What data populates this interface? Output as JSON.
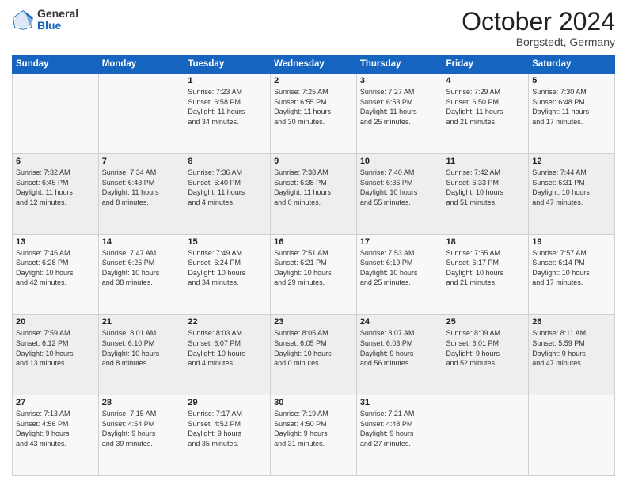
{
  "logo": {
    "general": "General",
    "blue": "Blue"
  },
  "header": {
    "month": "October 2024",
    "location": "Borgstedt, Germany"
  },
  "weekdays": [
    "Sunday",
    "Monday",
    "Tuesday",
    "Wednesday",
    "Thursday",
    "Friday",
    "Saturday"
  ],
  "weeks": [
    [
      {
        "day": "",
        "info": ""
      },
      {
        "day": "",
        "info": ""
      },
      {
        "day": "1",
        "info": "Sunrise: 7:23 AM\nSunset: 6:58 PM\nDaylight: 11 hours\nand 34 minutes."
      },
      {
        "day": "2",
        "info": "Sunrise: 7:25 AM\nSunset: 6:55 PM\nDaylight: 11 hours\nand 30 minutes."
      },
      {
        "day": "3",
        "info": "Sunrise: 7:27 AM\nSunset: 6:53 PM\nDaylight: 11 hours\nand 25 minutes."
      },
      {
        "day": "4",
        "info": "Sunrise: 7:29 AM\nSunset: 6:50 PM\nDaylight: 11 hours\nand 21 minutes."
      },
      {
        "day": "5",
        "info": "Sunrise: 7:30 AM\nSunset: 6:48 PM\nDaylight: 11 hours\nand 17 minutes."
      }
    ],
    [
      {
        "day": "6",
        "info": "Sunrise: 7:32 AM\nSunset: 6:45 PM\nDaylight: 11 hours\nand 12 minutes."
      },
      {
        "day": "7",
        "info": "Sunrise: 7:34 AM\nSunset: 6:43 PM\nDaylight: 11 hours\nand 8 minutes."
      },
      {
        "day": "8",
        "info": "Sunrise: 7:36 AM\nSunset: 6:40 PM\nDaylight: 11 hours\nand 4 minutes."
      },
      {
        "day": "9",
        "info": "Sunrise: 7:38 AM\nSunset: 6:38 PM\nDaylight: 11 hours\nand 0 minutes."
      },
      {
        "day": "10",
        "info": "Sunrise: 7:40 AM\nSunset: 6:36 PM\nDaylight: 10 hours\nand 55 minutes."
      },
      {
        "day": "11",
        "info": "Sunrise: 7:42 AM\nSunset: 6:33 PM\nDaylight: 10 hours\nand 51 minutes."
      },
      {
        "day": "12",
        "info": "Sunrise: 7:44 AM\nSunset: 6:31 PM\nDaylight: 10 hours\nand 47 minutes."
      }
    ],
    [
      {
        "day": "13",
        "info": "Sunrise: 7:45 AM\nSunset: 6:28 PM\nDaylight: 10 hours\nand 42 minutes."
      },
      {
        "day": "14",
        "info": "Sunrise: 7:47 AM\nSunset: 6:26 PM\nDaylight: 10 hours\nand 38 minutes."
      },
      {
        "day": "15",
        "info": "Sunrise: 7:49 AM\nSunset: 6:24 PM\nDaylight: 10 hours\nand 34 minutes."
      },
      {
        "day": "16",
        "info": "Sunrise: 7:51 AM\nSunset: 6:21 PM\nDaylight: 10 hours\nand 29 minutes."
      },
      {
        "day": "17",
        "info": "Sunrise: 7:53 AM\nSunset: 6:19 PM\nDaylight: 10 hours\nand 25 minutes."
      },
      {
        "day": "18",
        "info": "Sunrise: 7:55 AM\nSunset: 6:17 PM\nDaylight: 10 hours\nand 21 minutes."
      },
      {
        "day": "19",
        "info": "Sunrise: 7:57 AM\nSunset: 6:14 PM\nDaylight: 10 hours\nand 17 minutes."
      }
    ],
    [
      {
        "day": "20",
        "info": "Sunrise: 7:59 AM\nSunset: 6:12 PM\nDaylight: 10 hours\nand 13 minutes."
      },
      {
        "day": "21",
        "info": "Sunrise: 8:01 AM\nSunset: 6:10 PM\nDaylight: 10 hours\nand 8 minutes."
      },
      {
        "day": "22",
        "info": "Sunrise: 8:03 AM\nSunset: 6:07 PM\nDaylight: 10 hours\nand 4 minutes."
      },
      {
        "day": "23",
        "info": "Sunrise: 8:05 AM\nSunset: 6:05 PM\nDaylight: 10 hours\nand 0 minutes."
      },
      {
        "day": "24",
        "info": "Sunrise: 8:07 AM\nSunset: 6:03 PM\nDaylight: 9 hours\nand 56 minutes."
      },
      {
        "day": "25",
        "info": "Sunrise: 8:09 AM\nSunset: 6:01 PM\nDaylight: 9 hours\nand 52 minutes."
      },
      {
        "day": "26",
        "info": "Sunrise: 8:11 AM\nSunset: 5:59 PM\nDaylight: 9 hours\nand 47 minutes."
      }
    ],
    [
      {
        "day": "27",
        "info": "Sunrise: 7:13 AM\nSunset: 4:56 PM\nDaylight: 9 hours\nand 43 minutes."
      },
      {
        "day": "28",
        "info": "Sunrise: 7:15 AM\nSunset: 4:54 PM\nDaylight: 9 hours\nand 39 minutes."
      },
      {
        "day": "29",
        "info": "Sunrise: 7:17 AM\nSunset: 4:52 PM\nDaylight: 9 hours\nand 35 minutes."
      },
      {
        "day": "30",
        "info": "Sunrise: 7:19 AM\nSunset: 4:50 PM\nDaylight: 9 hours\nand 31 minutes."
      },
      {
        "day": "31",
        "info": "Sunrise: 7:21 AM\nSunset: 4:48 PM\nDaylight: 9 hours\nand 27 minutes."
      },
      {
        "day": "",
        "info": ""
      },
      {
        "day": "",
        "info": ""
      }
    ]
  ]
}
